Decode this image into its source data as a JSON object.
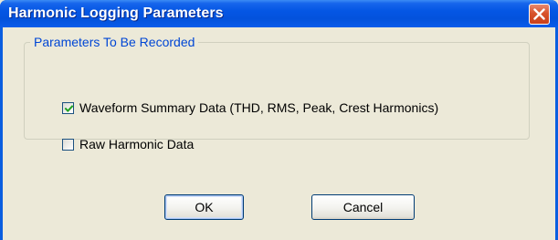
{
  "window": {
    "title": "Harmonic Logging Parameters"
  },
  "group": {
    "legend": "Parameters To Be Recorded",
    "options": [
      {
        "label": "Waveform Summary Data (THD, RMS, Peak, Crest Harmonics)",
        "checked": true
      },
      {
        "label": "Raw Harmonic Data",
        "checked": false
      }
    ]
  },
  "buttons": {
    "ok_label": "OK",
    "cancel_label": "Cancel"
  },
  "colors": {
    "titlebar": "#0456e4",
    "close_button": "#d8532c",
    "group_legend": "#0046d5",
    "dialog_background": "#ece9d8"
  }
}
